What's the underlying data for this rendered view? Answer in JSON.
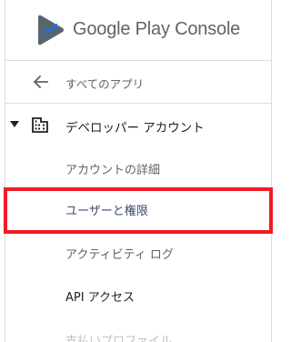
{
  "brand": {
    "name_part1": "Google Play",
    "name_part2": "Console",
    "logo_icon": "play-console-logo-icon"
  },
  "nav": {
    "back": {
      "label": "すべてのアプリ",
      "icon": "arrow-left-icon"
    },
    "section": {
      "label": "デベロッパー アカウント",
      "icon": "building-icon",
      "expanded": true,
      "items": [
        {
          "label": "アカウントの詳細"
        },
        {
          "label": "ユーザーと権限",
          "highlighted": true
        },
        {
          "label": "アクティビティ ログ"
        },
        {
          "label": "API アクセス"
        },
        {
          "label": "支払いプロファイル"
        }
      ]
    }
  },
  "colors": {
    "highlight_border": "#ee1c25",
    "text_primary": "#202124",
    "text_secondary": "#5f6368",
    "divider": "#dadce0"
  }
}
